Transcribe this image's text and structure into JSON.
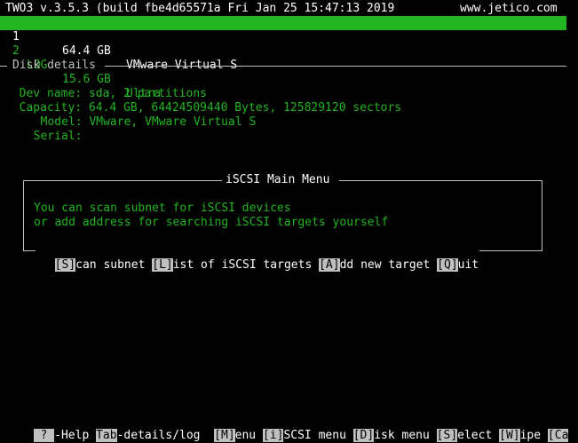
{
  "header": {
    "title": "TWO3 v.3.5.3 (build fbe4d65571a Fri Jan 25 15:47:13 2019",
    "site": "www.jetico.com"
  },
  "disks": [
    {
      "num": "1",
      "size": "64.4 GB",
      "model": "VMware Virtual S",
      "selected": true
    },
    {
      "num": "2",
      "name": "LOG",
      "size": "15.6 GB",
      "model": "Ultra",
      "selected": false
    }
  ],
  "details": {
    "title": "Disk details",
    "rows": [
      {
        "label": "Dev name:",
        "value": "sda, 2 partitions"
      },
      {
        "label": "Capacity:",
        "value": "64.4 GB, 64424509440 Bytes, 125829120 sectors"
      },
      {
        "label": "Model:",
        "value": "VMware, VMware Virtual S"
      },
      {
        "label": "Serial:",
        "value": ""
      }
    ]
  },
  "dialog": {
    "title": "iSCSI Main Menu",
    "lines": [
      "You can scan subnet for iSCSI devices",
      "or add address for searching iSCSI targets yourself"
    ],
    "actions": [
      {
        "key": "[S]",
        "rest": "can subnet"
      },
      {
        "key": "[L]",
        "rest": "ist of iSCSI targets"
      },
      {
        "key": "[A]",
        "rest": "dd new target"
      },
      {
        "key": "[Q]",
        "rest": "uit"
      }
    ]
  },
  "footer": [
    {
      "key": " ? ",
      "rest": "-Help"
    },
    {
      "key": "Tab",
      "rest": "-details/log"
    },
    {
      "key": "[M]",
      "rest": "enu"
    },
    {
      "key": "[i]",
      "rest": "SCSI menu"
    },
    {
      "key": "[D]",
      "rest": "isk menu"
    },
    {
      "key": "[S]",
      "rest": "elect"
    },
    {
      "key": "[W]",
      "rest": "ipe"
    },
    {
      "key": "[Ca",
      "rest": ""
    }
  ],
  "colors": {
    "accent": "#21b521",
    "text": "#c0c0c0",
    "white": "#ffffff",
    "background": "#000000"
  }
}
